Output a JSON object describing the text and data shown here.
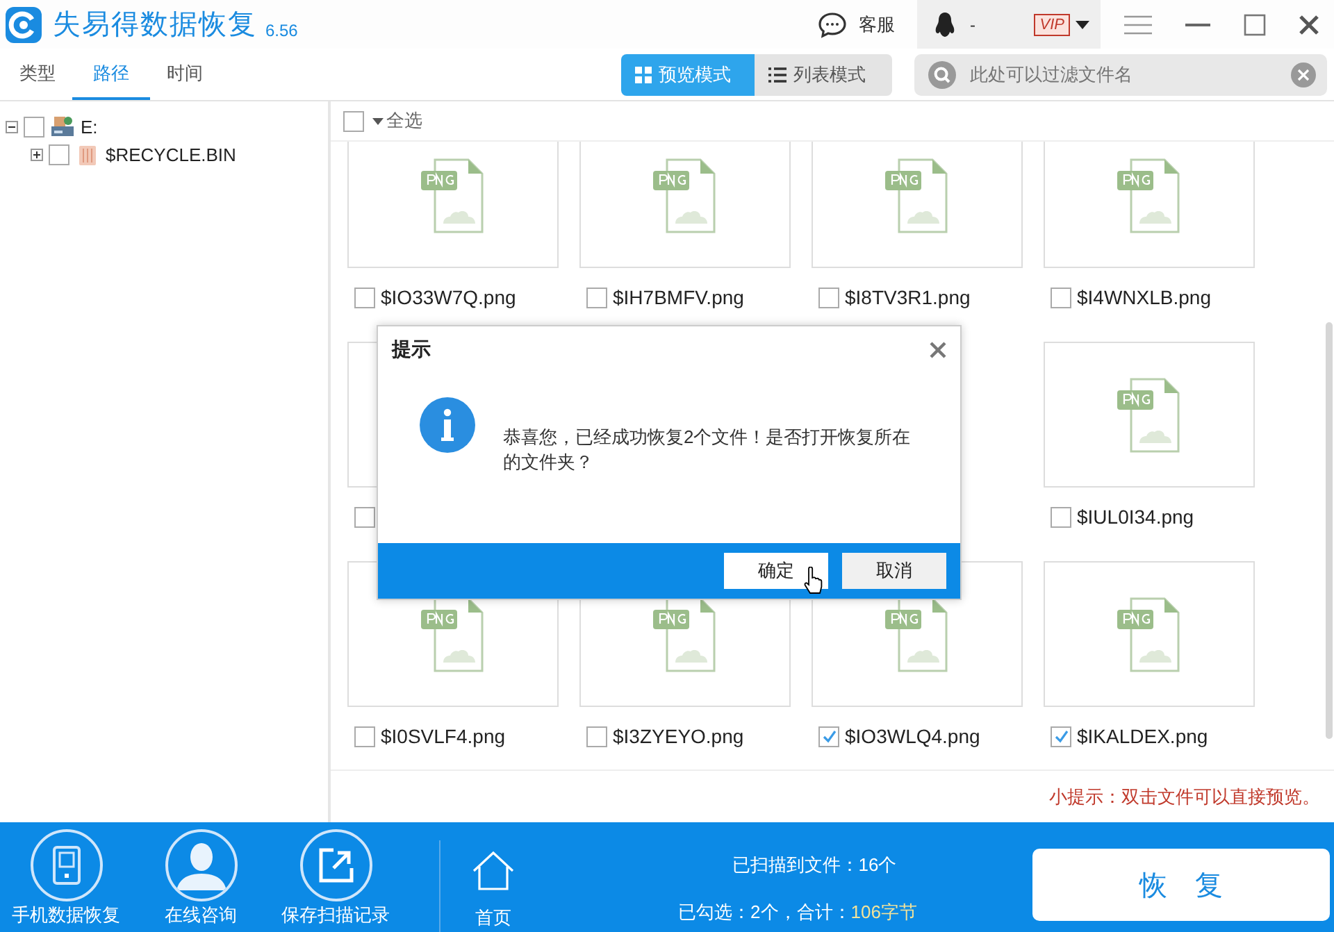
{
  "app": {
    "title": "失易得数据恢复",
    "version": "6.56"
  },
  "header": {
    "support": "客服",
    "account": "-",
    "vip": "VIP"
  },
  "tabs": [
    {
      "label": "类型",
      "selected": false
    },
    {
      "label": "路径",
      "selected": true
    },
    {
      "label": "时间",
      "selected": false
    }
  ],
  "view_modes": [
    {
      "label": "预览模式",
      "kind": "grid",
      "selected": true
    },
    {
      "label": "列表模式",
      "kind": "list",
      "selected": false
    }
  ],
  "search": {
    "placeholder": "此处可以过滤文件名"
  },
  "tree": [
    {
      "label": "E:",
      "kind": "drive",
      "expanded": true,
      "checked": false,
      "children": [
        {
          "label": "$RECYCLE.BIN",
          "kind": "bin",
          "expanded": false,
          "checked": false
        }
      ]
    }
  ],
  "select_all": {
    "label": "全选",
    "checked": false
  },
  "file_rows": [
    [
      {
        "name": "$IO33W7Q.png",
        "checked": false
      },
      {
        "name": "$IH7BMFV.png",
        "checked": false
      },
      {
        "name": "$I8TV3R1.png",
        "checked": false
      },
      {
        "name": "$I4WNXLB.png",
        "checked": false
      }
    ],
    [
      {
        "checked": false
      },
      {
        "name": "$IUL0I34.png",
        "checked": false
      }
    ],
    [
      {
        "name": "$I0SVLF4.png",
        "checked": false
      },
      {
        "name": "$I3ZYEYO.png",
        "checked": false
      },
      {
        "name": "$IO3WLQ4.png",
        "checked": true
      },
      {
        "name": "$IKALDEX.png",
        "checked": true
      }
    ]
  ],
  "tip": "小提示：双击文件可以直接预览。",
  "footer": {
    "actions": [
      {
        "label": "手机数据恢复",
        "kind": "phone"
      },
      {
        "label": "在线咨询",
        "kind": "person"
      },
      {
        "label": "保存扫描记录",
        "kind": "export"
      }
    ],
    "home": "首页",
    "scanned": "已扫描到文件：16个",
    "selected_label": "已勾选：2个，合计：",
    "selected_size": "106字节",
    "recover": "恢　复"
  },
  "dialog": {
    "title": "提示",
    "message": "恭喜您，已经成功恢复2个文件！是否打开恢复所在的文件夹？",
    "buttons": [
      {
        "label": "确定",
        "selected": true
      },
      {
        "label": "取消",
        "selected": false
      }
    ]
  }
}
